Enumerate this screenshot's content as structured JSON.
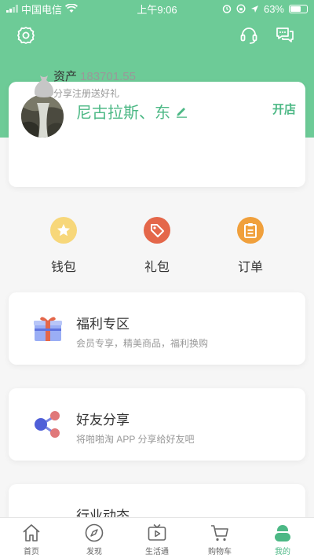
{
  "statusbar": {
    "carrier": "中国电信",
    "time": "上午9:06",
    "battery": "63%",
    "battery_level": 0.63
  },
  "profile": {
    "username": "尼古拉斯、东",
    "shop_label": "开店",
    "asset_label": "资产",
    "asset_value": "183701.55",
    "asset_sub": "分享注册送好礼"
  },
  "quick_actions": [
    {
      "label": "钱包",
      "icon": "star-icon",
      "color": "#f7d77a"
    },
    {
      "label": "礼包",
      "icon": "tag-icon",
      "color": "#e4674a"
    },
    {
      "label": "订单",
      "icon": "clipboard-icon",
      "color": "#f0a03c"
    }
  ],
  "features": [
    {
      "title": "福利专区",
      "subtitle": "会员专享，精美商品，福利换购",
      "icon": "gift-icon"
    },
    {
      "title": "好友分享",
      "subtitle": "将啪啪淘 APP 分享给好友吧",
      "icon": "share-icon"
    },
    {
      "title": "行业动态",
      "subtitle": "",
      "icon": "news-icon"
    }
  ],
  "tabbar": [
    {
      "label": "首页",
      "icon": "home-icon"
    },
    {
      "label": "发现",
      "icon": "compass-icon"
    },
    {
      "label": "生活通",
      "icon": "tv-icon"
    },
    {
      "label": "购物车",
      "icon": "cart-icon"
    },
    {
      "label": "我的",
      "icon": "profile-icon",
      "active": true
    }
  ],
  "colors": {
    "brand": "#6dcb97",
    "accent": "#4cb885"
  }
}
